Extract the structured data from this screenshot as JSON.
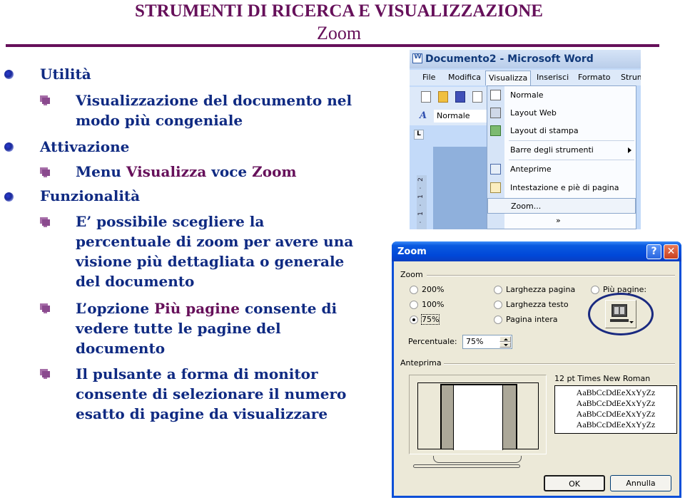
{
  "header": {
    "title": "STRUMENTI DI RICERCA E VISUALIZZAZIONE",
    "subtitle": "Zoom"
  },
  "colors": {
    "accent": "#66105a",
    "text": "#0f2a82",
    "dialog_titlebar": "#0a5ae0",
    "dialog_bg": "#ece9d8",
    "word_bg": "#c3daf9"
  },
  "outline": [
    {
      "heading": "Utilità",
      "items": [
        {
          "lines": [
            "Visualizzazione del documento nel",
            "modo più congeniale"
          ]
        }
      ]
    },
    {
      "heading": "Attivazione",
      "items": [
        {
          "parts": [
            "Menu ",
            "Visualizza",
            " voce ",
            "Zoom"
          ]
        }
      ]
    },
    {
      "heading": "Funzionalità",
      "items": [
        {
          "lines": [
            "E’ possibile scegliere la",
            "percentuale di zoom per avere una",
            "visione più dettagliata o generale",
            "del documento"
          ]
        },
        {
          "line1_parts": [
            "L’opzione ",
            "Più pagine",
            " consente di"
          ],
          "lines": [
            "vedere tutte le pagine del",
            "documento"
          ]
        },
        {
          "lines": [
            "Il pulsante a forma di monitor",
            "consente di selezionare il numero",
            "esatto di pagine da visualizzare"
          ]
        }
      ]
    }
  ],
  "word_window": {
    "title": "Documento2 - Microsoft Word",
    "menubar": [
      "File",
      "Modifica",
      "Visualizza",
      "Inserisci",
      "Formato",
      "Strum"
    ],
    "active_menu": "Visualizza",
    "style_box": "Normale",
    "ruler_corner": "L",
    "vruler": [
      "2",
      "·",
      "1",
      "·",
      "1",
      "·"
    ],
    "view_menu": [
      {
        "label": "Normale",
        "icon": "normal-view-icon"
      },
      {
        "label": "Layout Web",
        "icon": "web-layout-icon"
      },
      {
        "label": "Layout di stampa",
        "icon": "print-layout-icon"
      },
      {
        "label": "Barre degli strumenti",
        "submenu": true
      },
      {
        "label": "Anteprime",
        "icon": "thumbnails-icon"
      },
      {
        "label": "Intestazione e piè di pagina",
        "icon": "header-footer-icon"
      },
      {
        "label": "Zoom...",
        "highlighted": true
      }
    ],
    "more_glyph": "»"
  },
  "zoom_dialog": {
    "title": "Zoom",
    "help_glyph": "?",
    "close_glyph": "✕",
    "zoom_group_label": "Zoom",
    "options_col1": [
      {
        "label": "200%",
        "selected": false
      },
      {
        "label": "100%",
        "selected": false
      },
      {
        "label": "75%",
        "selected": true
      }
    ],
    "options_col2": [
      {
        "label": "Larghezza pagina",
        "selected": false
      },
      {
        "label": "Larghezza testo",
        "selected": false
      },
      {
        "label": "Pagina intera",
        "selected": false
      }
    ],
    "option_more_pages": {
      "label": "Più pagine:",
      "selected": false
    },
    "percent_label": "Percentuale:",
    "percent_value": "75%",
    "preview_group_label": "Anteprima",
    "font_label": "12 pt Times New Roman",
    "font_samples": [
      "AaBbCcDdEeXxYyZz",
      "AaBbCcDdEeXxYyZz",
      "AaBbCcDdEeXxYyZz",
      "AaBbCcDdEeXxYyZz"
    ],
    "ok_label": "OK",
    "cancel_label": "Annulla"
  }
}
